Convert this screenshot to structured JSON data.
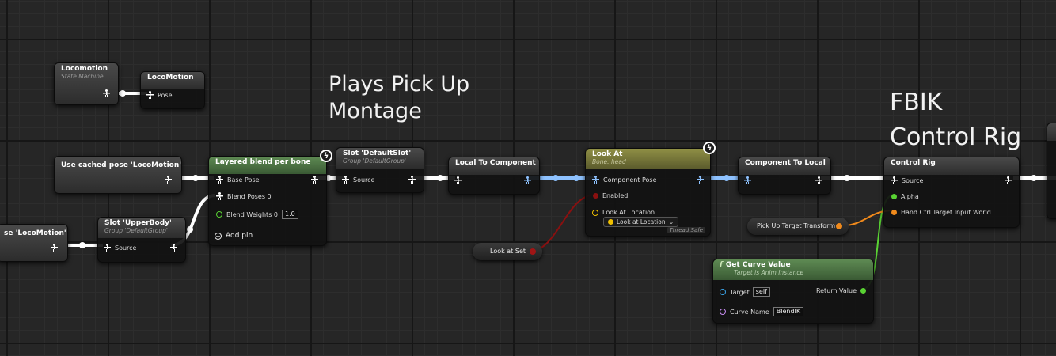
{
  "comments": {
    "pickup_line1": "Plays Pick Up",
    "pickup_line2": "Montage",
    "fbik_line1": "FBIK",
    "fbik_line2": "Control Rig"
  },
  "nodes": {
    "locomotion_sm": {
      "title": "Locomotion",
      "subtitle": "State Machine"
    },
    "locomotion_cache": {
      "title": "LocoMotion",
      "pin": "Pose"
    },
    "use_cached_1": {
      "title": "Use cached pose 'LocoMotion'"
    },
    "use_cached_2": {
      "title": "se 'LocoMotion'"
    },
    "slot_upper": {
      "title": "Slot 'UpperBody'",
      "subtitle": "Group 'DefaultGroup'",
      "pin": "Source"
    },
    "layered": {
      "title": "Layered blend per bone",
      "base_pose": "Base Pose",
      "blend_poses": "Blend Poses 0",
      "blend_weights": "Blend Weights 0",
      "blend_weights_value": "1.0",
      "add_pin": "Add pin"
    },
    "slot_default": {
      "title": "Slot 'DefaultSlot'",
      "subtitle": "Group 'DefaultGroup'",
      "pin": "Source"
    },
    "local_to_component": {
      "title": "Local To Component"
    },
    "look_at": {
      "title": "Look At",
      "subtitle": "Bone: head",
      "component_pose": "Component Pose",
      "enabled": "Enabled",
      "look_at_location": "Look At Location",
      "dropdown": "Look at Location",
      "thread_safe": "Thread Safe"
    },
    "look_at_set": {
      "title": "Look at Set"
    },
    "component_to_local": {
      "title": "Component To Local"
    },
    "control_rig": {
      "title": "Control Rig",
      "source": "Source",
      "alpha": "Alpha",
      "hand_ctrl": "Hand Ctrl Target Input World"
    },
    "pickup_transform": {
      "title": "Pick Up Target Transform"
    },
    "get_curve": {
      "title": "Get Curve Value",
      "subtitle": "Target is Anim Instance",
      "target": "Target",
      "target_value": "self",
      "curve_name": "Curve Name",
      "curve_value": "BlendIK",
      "return_value": "Return Value"
    }
  },
  "colors": {
    "pose_wire": "#ffffff",
    "component_wire": "#8ec2ff",
    "bool_wire": "#8a1010",
    "float_wire": "#59d233",
    "transform_wire": "#f08a1c",
    "object_pin": "#3aa3e8",
    "name_pin": "#c68cf0",
    "vector_pin": "#f0c000"
  },
  "icons": [
    "person-pose-icon",
    "fast-path-bolt-icon",
    "function-icon",
    "dropdown-chevron-icon",
    "add-pin-icon"
  ]
}
